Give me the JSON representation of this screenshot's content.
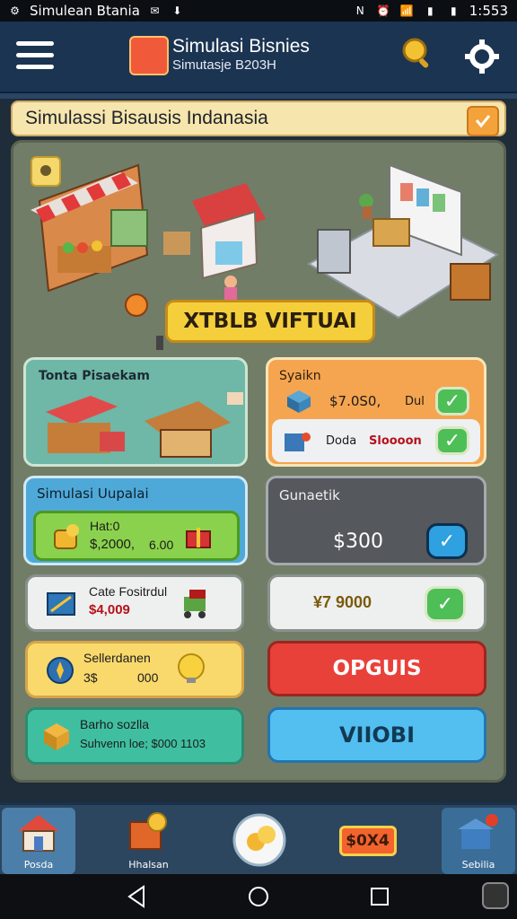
{
  "status_bar": {
    "left_text": "Simulean Btania",
    "time": "1:553"
  },
  "header": {
    "title": "Simulasi Bisnies",
    "subtitle": "Simutasje B203H"
  },
  "banner": {
    "title": "Simulassi Bisausis Indanasia"
  },
  "scene": {
    "button_label": "XTBLB VIFTUAI"
  },
  "market_card": {
    "label": "Tonta Pisaekam"
  },
  "orange_card": {
    "label": "Syaikn",
    "row1": {
      "value": "$7.0S0,",
      "extra": "Dul"
    },
    "row2": {
      "label": "Doda",
      "value": "Sloooon"
    }
  },
  "sim_box": {
    "label": "Simulasi Uupalai",
    "item_label": "Hat:0",
    "item_value": "$,2000,",
    "item_extra": "6.00"
  },
  "grey_box": {
    "label": "Gunaetik",
    "price": "$300"
  },
  "tile1": {
    "label": "Cate Fositrdul",
    "value": "$4,009"
  },
  "tile2": {
    "value": "¥7 9000"
  },
  "tile3": {
    "label": "Sellerdanen",
    "left": "3$",
    "right": "000"
  },
  "tile4": {
    "label": "Barho sozlla",
    "sub": "Suhvenn loe; $000 1103"
  },
  "btn_red": {
    "label": "OPGUIS"
  },
  "btn_blue": {
    "label": "VIIOBI"
  },
  "nav": [
    {
      "label": "Posda"
    },
    {
      "label": "Hhalsan"
    },
    {
      "label": ""
    },
    {
      "label": "$0X4"
    },
    {
      "label": "Sebilia"
    }
  ],
  "colors": {
    "accent_yellow": "#f5cf3b",
    "accent_red": "#e8413a",
    "accent_blue": "#53bff0",
    "check_green": "#4ebe56"
  }
}
